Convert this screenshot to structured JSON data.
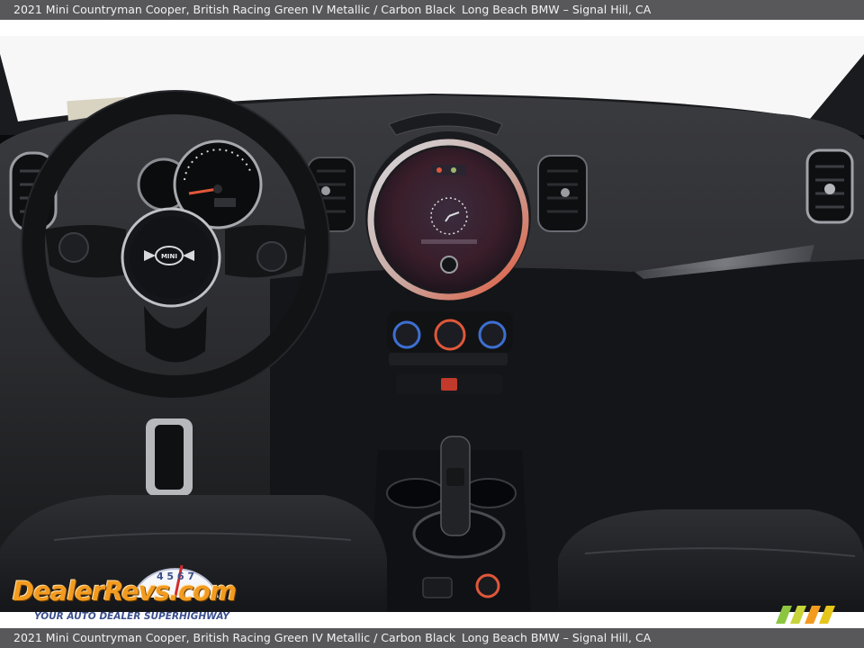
{
  "caption": {
    "vehicle": "2021 Mini Countryman Cooper,  British Racing Green IV Metallic / Carbon Black",
    "dealer": "Long Beach BMW – Signal Hill, CA"
  },
  "watermark": {
    "brand": "DealerRevs.com",
    "tagline": "YOUR AUTO DEALER SUPERHIGHWAY",
    "gauge_digits": "4 5 6 7"
  },
  "badge": {
    "steering_wheel": "MINI"
  },
  "colors": {
    "caption_bg": "#58585a",
    "caption_text": "#f2f2f2",
    "interior": "#1c1d20",
    "ambient_ring": "#e0573a",
    "watermark_orange": "#f29b1f",
    "watermark_blue": "#3a4e8c"
  }
}
